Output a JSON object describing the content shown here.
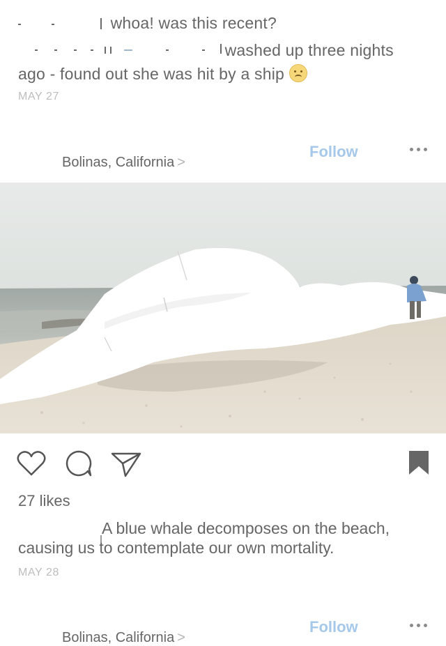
{
  "comments": [
    {
      "text": "whoa! was this recent?"
    },
    {
      "text": "washed up three nights",
      "continuation": "ago - found out she was hit by a ship"
    }
  ],
  "comments_date": "MAY 27",
  "post1": {
    "location": "Bolinas, California",
    "location_chevron": ">",
    "follow_label": "Follow",
    "more_icon": "more-horizontal-icon",
    "photo_icon": "beach-photo",
    "likes": "27 likes",
    "caption": "A blue whale decomposes on the beach, causing us to contemplate our own mortality.",
    "date": "MAY 28"
  },
  "post2": {
    "location": "Bolinas, California",
    "location_chevron": ">",
    "follow_label": "Follow"
  },
  "colors": {
    "follow": "#a6c8ea",
    "text": "#666666",
    "date": "#bdbdbd"
  }
}
